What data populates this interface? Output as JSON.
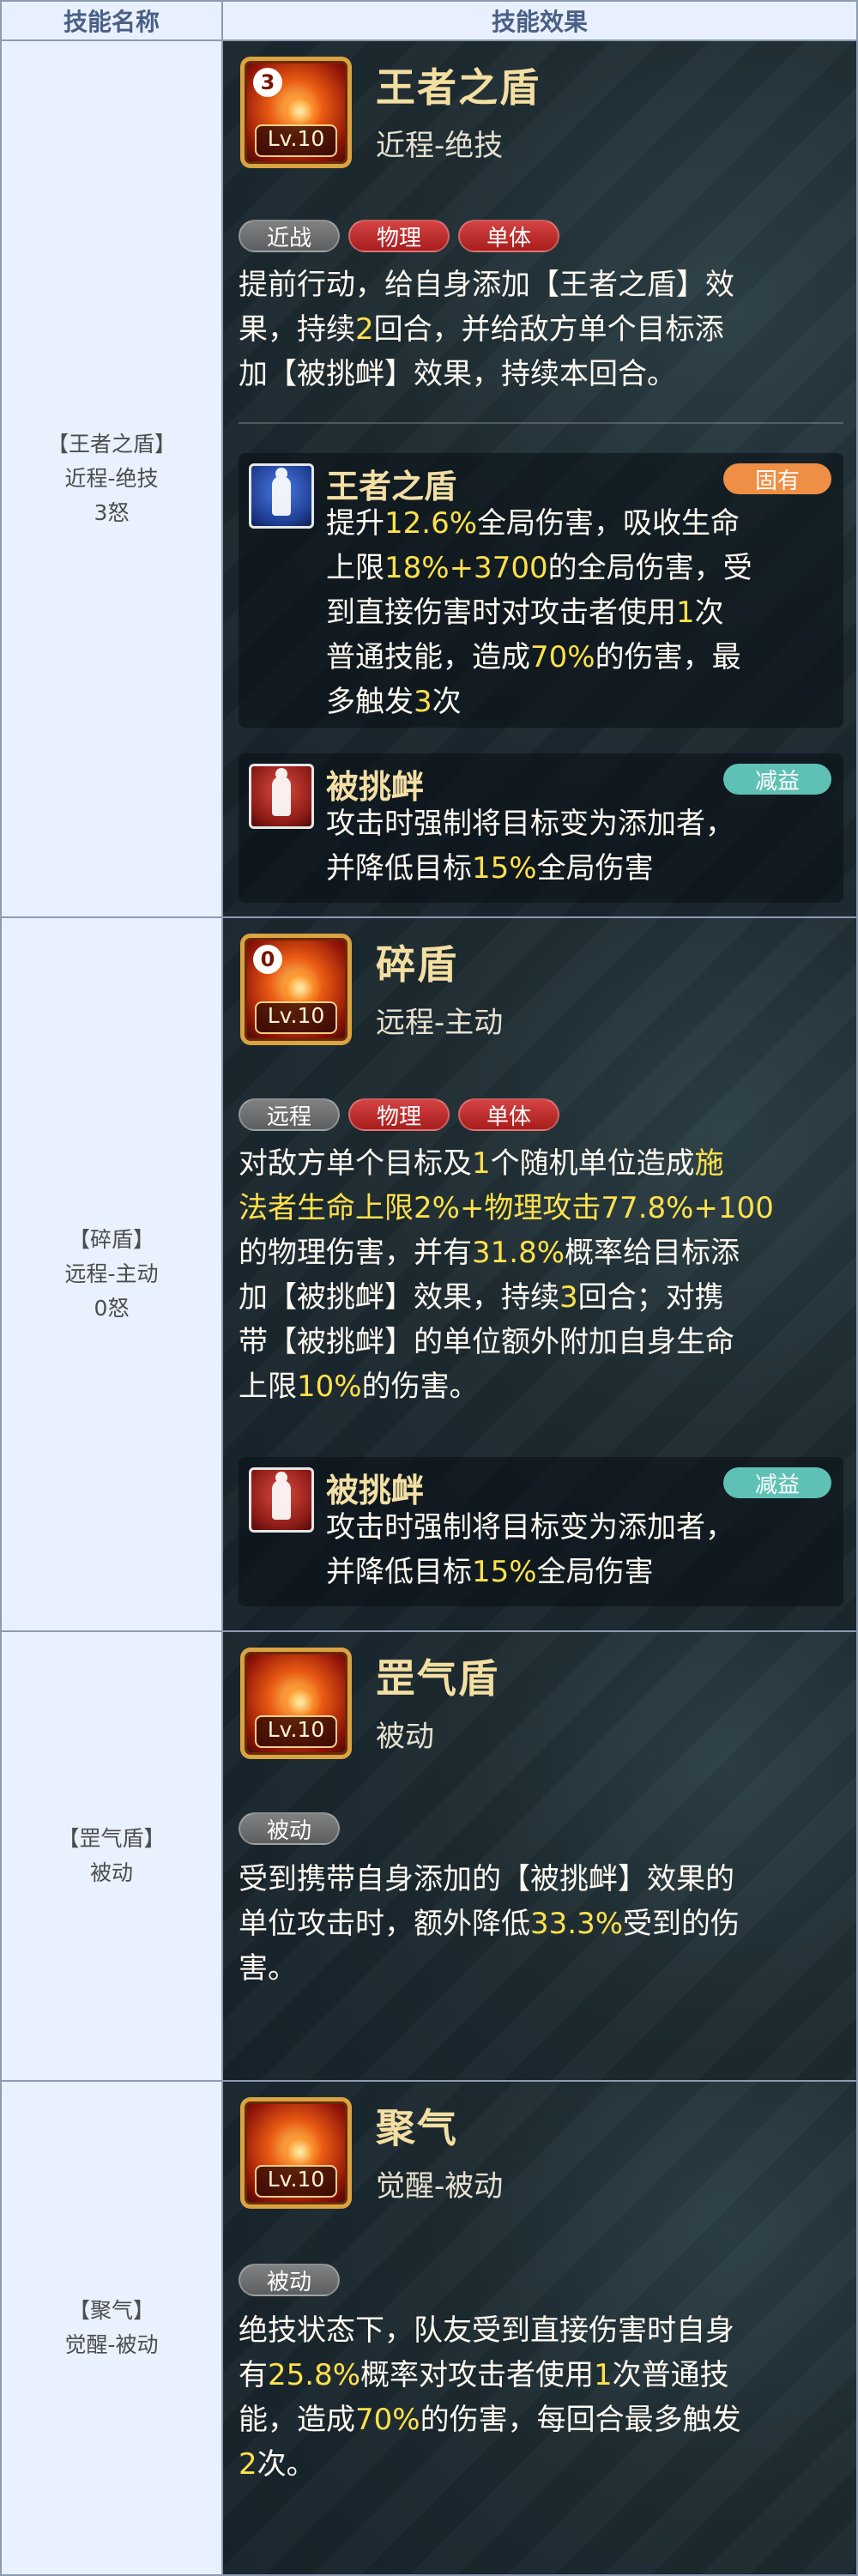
{
  "header": {
    "col1": "技能名称",
    "col2": "技能效果"
  },
  "rows": [
    {
      "left": [
        "【王者之盾】",
        "近程-绝技",
        "3怒"
      ],
      "icon": {
        "count": "3",
        "level": "Lv.10"
      },
      "name": "王者之盾",
      "type": "近程-绝技",
      "tags": [
        "近战",
        "物理",
        "单体"
      ],
      "desc_lines": [
        [
          "提前行动，给自身添加【王者之盾】效"
        ],
        [
          "果，持续",
          {
            "hl": "2"
          },
          "回合，并给敌方单个目标添"
        ],
        [
          "加【被挑衅】效果，持续本回合。"
        ]
      ],
      "subs": [
        {
          "title": "王者之盾",
          "badge": "固有",
          "icon": "shield-figure-icon",
          "desc_lines": [
            [
              "提升",
              {
                "hl": "12.6%"
              },
              "全局伤害，吸收生命"
            ],
            [
              "上限",
              {
                "hl": "18%+3700"
              },
              "的全局伤害，受"
            ],
            [
              "到直接伤害时对攻击者使用",
              {
                "hl": "1"
              },
              "次"
            ],
            [
              "普通技能，造成",
              {
                "hl": "70%"
              },
              "的伤害，最"
            ],
            [
              "多触发",
              {
                "hl": "3"
              },
              "次"
            ]
          ]
        },
        {
          "title": "被挑衅",
          "badge": "减益",
          "icon": "taunt-figure-icon",
          "desc_lines": [
            [
              "攻击时强制将目标变为添加者，"
            ],
            [
              "并降低目标",
              {
                "hl": "15%"
              },
              "全局伤害"
            ]
          ]
        }
      ]
    },
    {
      "left": [
        "【碎盾】",
        "远程-主动",
        "0怒"
      ],
      "icon": {
        "count": "0",
        "level": "Lv.10"
      },
      "name": "碎盾",
      "type": "远程-主动",
      "tags": [
        "远程",
        "物理",
        "单体"
      ],
      "desc_lines": [
        [
          "对敌方单个目标及",
          {
            "hl": "1"
          },
          "个随机单位造成",
          {
            "hl": "施"
          }
        ],
        [
          {
            "hl": "法者生命上限2%+物理攻击77.8%+100"
          }
        ],
        [
          "的物理伤害，并有",
          {
            "hl": "31.8%"
          },
          "概率给目标添"
        ],
        [
          "加【被挑衅】效果，持续",
          {
            "hl": "3"
          },
          "回合；对携"
        ],
        [
          "带【被挑衅】的单位额外附加自身生命"
        ],
        [
          "上限",
          {
            "hl": "10%"
          },
          "的伤害。"
        ]
      ],
      "subs": [
        {
          "title": "被挑衅",
          "badge": "减益",
          "icon": "taunt-figure-icon",
          "desc_lines": [
            [
              "攻击时强制将目标变为添加者，"
            ],
            [
              "并降低目标",
              {
                "hl": "15%"
              },
              "全局伤害"
            ]
          ]
        }
      ]
    },
    {
      "left": [
        "【罡气盾】",
        "被动"
      ],
      "icon": {
        "count": "",
        "level": "Lv.10"
      },
      "name": "罡气盾",
      "type": "被动",
      "tags": [
        "被动"
      ],
      "desc_lines": [
        [
          "受到携带自身添加的【被挑衅】效果的"
        ],
        [
          "单位攻击时，额外降低",
          {
            "hl": "33.3%"
          },
          "受到的伤"
        ],
        [
          "害。"
        ]
      ],
      "subs": []
    },
    {
      "left": [
        "【聚气】",
        "觉醒-被动"
      ],
      "icon": {
        "count": "",
        "level": "Lv.10"
      },
      "name": "聚气",
      "type": "觉醒-被动",
      "tags": [
        "被动"
      ],
      "desc_lines": [
        [
          "绝技状态下，队友受到直接伤害时自身"
        ],
        [
          "有",
          {
            "hl": "25.8%"
          },
          "概率对攻击者使用",
          {
            "hl": "1"
          },
          "次普通技"
        ],
        [
          "能，造成",
          {
            "hl": "70%"
          },
          "的伤害，每回合最多触发"
        ],
        [
          {
            "hl": "2"
          },
          "次。"
        ]
      ],
      "subs": []
    }
  ]
}
